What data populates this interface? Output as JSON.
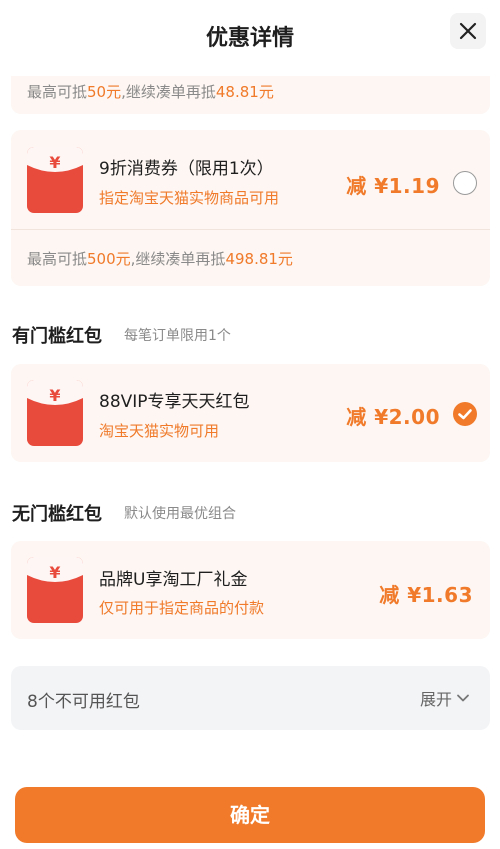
{
  "header": {
    "title": "优惠详情",
    "close_icon": "close-icon"
  },
  "partial_card": {
    "text_prefix": "最高可抵",
    "cap": "50元",
    "text_mid": ",继续凑单再抵",
    "more": "48.81元"
  },
  "coupon_card": {
    "title": "9折消费券（限用1次）",
    "subtitle": "指定淘宝天猫实物商品可用",
    "amount": "减 ¥1.19",
    "checked": false,
    "footer_prefix": "最高可抵",
    "footer_cap": "500元",
    "footer_mid": ",继续凑单再抵",
    "footer_more": "498.81元"
  },
  "threshold_section": {
    "title": "有门槛红包",
    "subtitle": "每笔订单限用1个",
    "item": {
      "title": "88VIP专享天天红包",
      "subtitle": "淘宝天猫实物可用",
      "amount": "减 ¥2.00",
      "checked": true
    }
  },
  "no_threshold_section": {
    "title": "无门槛红包",
    "subtitle": "默认使用最优组合",
    "item": {
      "title": "品牌U享淘工厂礼金",
      "subtitle": "仅可用于指定商品的付款",
      "amount": "减 ¥1.63"
    }
  },
  "unavailable": {
    "label": "8个不可用红包",
    "expand_label": "展开"
  },
  "confirm": {
    "label": "确定"
  },
  "colors": {
    "accent": "#f07a2a",
    "red_packet": "#e84a3c",
    "card_bg": "#fdf6f2"
  }
}
